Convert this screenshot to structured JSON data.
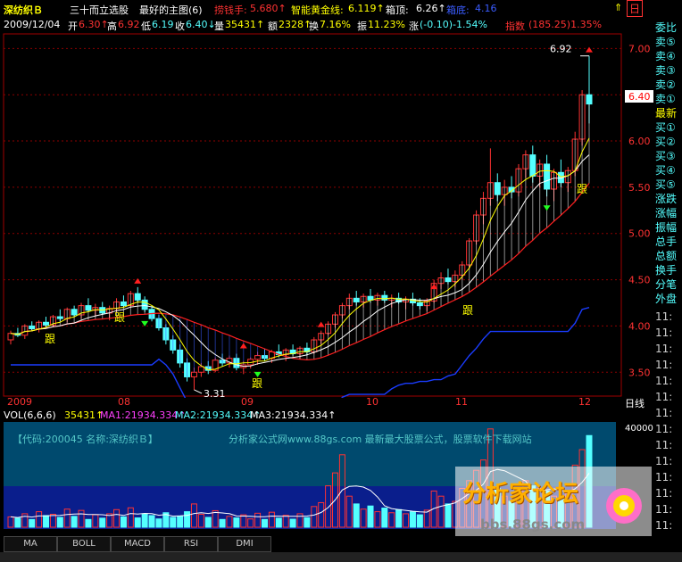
{
  "header": {
    "stock_name": "深纺织Ｂ",
    "indicator_title": "三十而立选股",
    "main_chart_label": "最好的主图(6)",
    "param1_label": "捞钱手:",
    "param1_value": "5.680↑",
    "param2_label": "智能黄金线:",
    "param2_value": "6.119↑",
    "param3_label": "箱顶:",
    "param3_value": "6.26↑",
    "param4_label": "箱底:",
    "param4_value": "4.16"
  },
  "quote": {
    "date": "2009/12/04",
    "open_label": "开",
    "open": "6.30↑",
    "high_label": "高",
    "high": "6.92",
    "low_label": "低",
    "low": "6.19",
    "close_label": "收",
    "close": "6.40↓",
    "volume_label": "量",
    "volume": "35431↑",
    "amount_label": "额",
    "amount": "2328↑",
    "turnover_label": "换",
    "turnover": "7.16%",
    "amplitude_label": "振",
    "amplitude": "11.23%",
    "change_label": "涨",
    "change": "(-0.10)-1.54%",
    "index_label": "指数",
    "index": "(185.25)1.35%"
  },
  "price_axis": [
    "7.00",
    "6.50",
    "6.00",
    "5.50",
    "5.00",
    "4.50",
    "4.00",
    "3.50"
  ],
  "current_price_badge": "6.40",
  "annotations": {
    "high_marker": "6.92",
    "low_marker": "3.31",
    "follow_label": "跟"
  },
  "x_axis_labels": [
    "2009",
    "08",
    "09",
    "10",
    "11",
    "12"
  ],
  "period_label": "日线",
  "volume_header": {
    "label": "VOL(6,6,6)",
    "value": "35431↑",
    "ma1": "MA1:21934.334↑",
    "ma2": "MA2:21934.334↑",
    "ma3": "MA3:21934.334↑"
  },
  "vol_axis": [
    "40000"
  ],
  "info_banner": {
    "code": "【代码:200045  名称:深纺织Ｂ】",
    "site": "分析家公式网www.88gs.com 最新最大股票公式，股票软件下载网站"
  },
  "tabs": [
    "MA",
    "BOLL",
    "MACD",
    "RSI",
    "DMI"
  ],
  "side_panel": {
    "top_title": "委比",
    "rows": [
      "卖⑤",
      "卖④",
      "卖③",
      "卖②",
      "卖①",
      "最新",
      "买①",
      "买②",
      "买③",
      "买④",
      "买⑤",
      "涨跌",
      "涨幅",
      "振幅",
      "总手",
      "总额",
      "换手",
      "分笔",
      "外盘"
    ],
    "times": [
      "11:",
      "11:",
      "11:",
      "11:",
      "11:",
      "11:",
      "11:",
      "11:",
      "11:",
      "11:",
      "11:",
      "11:",
      "11:",
      "11:",
      "11:"
    ]
  },
  "watermark": {
    "title": "分析家论坛",
    "url": "bbs.88gs.com"
  },
  "colors": {
    "up": "#ff3232",
    "down": "#54ffff",
    "ma_white": "#ffffff",
    "ma_yellow": "#ffff00",
    "box_line": "#1a3cff",
    "grid": "#8b0000",
    "header_yellow": "#ffff00",
    "header_red": "#ff3232",
    "banner_cyan": "#54c8c8"
  },
  "chart_data": {
    "type": "candlestick",
    "y_range": [
      3.3,
      7.1
    ],
    "volume_range": [
      0,
      40000
    ],
    "months": [
      "2009",
      "08",
      "09",
      "10",
      "11",
      "12"
    ],
    "ohlc": [
      [
        3.85,
        3.95,
        3.8,
        3.92
      ],
      [
        3.92,
        3.98,
        3.88,
        3.9
      ],
      [
        3.9,
        4.02,
        3.86,
        4.0
      ],
      [
        4.0,
        4.05,
        3.95,
        3.97
      ],
      [
        3.97,
        4.06,
        3.93,
        4.04
      ],
      [
        4.04,
        4.1,
        3.98,
        4.01
      ],
      [
        4.01,
        4.12,
        3.99,
        4.1
      ],
      [
        4.1,
        4.18,
        4.05,
        4.08
      ],
      [
        4.08,
        4.2,
        4.04,
        4.18
      ],
      [
        4.18,
        4.22,
        4.1,
        4.12
      ],
      [
        4.12,
        4.25,
        4.08,
        4.22
      ],
      [
        4.22,
        4.3,
        4.15,
        4.17
      ],
      [
        4.17,
        4.24,
        4.1,
        4.2
      ],
      [
        4.2,
        4.26,
        4.12,
        4.14
      ],
      [
        4.14,
        4.22,
        4.06,
        4.19
      ],
      [
        4.19,
        4.3,
        4.15,
        4.26
      ],
      [
        4.26,
        4.33,
        4.2,
        4.22
      ],
      [
        4.22,
        4.38,
        4.2,
        4.35
      ],
      [
        4.35,
        4.42,
        4.25,
        4.28
      ],
      [
        4.28,
        4.32,
        4.15,
        4.18
      ],
      [
        4.18,
        4.22,
        4.05,
        4.08
      ],
      [
        4.08,
        4.12,
        3.95,
        3.98
      ],
      [
        3.98,
        4.02,
        3.8,
        3.85
      ],
      [
        3.85,
        3.9,
        3.7,
        3.74
      ],
      [
        3.74,
        3.8,
        3.55,
        3.6
      ],
      [
        3.6,
        3.65,
        3.4,
        3.45
      ],
      [
        3.45,
        3.55,
        3.31,
        3.5
      ],
      [
        3.5,
        3.6,
        3.45,
        3.56
      ],
      [
        3.56,
        3.62,
        3.48,
        3.52
      ],
      [
        3.52,
        3.66,
        3.5,
        3.63
      ],
      [
        3.63,
        3.7,
        3.56,
        3.6
      ],
      [
        3.6,
        3.68,
        3.55,
        3.65
      ],
      [
        3.65,
        3.7,
        3.52,
        3.55
      ],
      [
        3.55,
        3.62,
        3.48,
        3.58
      ],
      [
        3.58,
        3.66,
        3.54,
        3.64
      ],
      [
        3.64,
        3.72,
        3.58,
        3.68
      ],
      [
        3.68,
        3.75,
        3.62,
        3.65
      ],
      [
        3.65,
        3.74,
        3.6,
        3.72
      ],
      [
        3.72,
        3.8,
        3.66,
        3.69
      ],
      [
        3.69,
        3.76,
        3.62,
        3.74
      ],
      [
        3.74,
        3.8,
        3.68,
        3.7
      ],
      [
        3.7,
        3.78,
        3.64,
        3.76
      ],
      [
        3.76,
        3.82,
        3.68,
        3.72
      ],
      [
        3.72,
        3.88,
        3.7,
        3.85
      ],
      [
        3.85,
        3.95,
        3.8,
        3.92
      ],
      [
        3.92,
        4.05,
        3.9,
        4.02
      ],
      [
        4.02,
        4.15,
        3.98,
        4.12
      ],
      [
        4.12,
        4.25,
        4.08,
        4.22
      ],
      [
        4.22,
        4.35,
        4.18,
        4.3
      ],
      [
        4.3,
        4.38,
        4.22,
        4.26
      ],
      [
        4.26,
        4.35,
        4.2,
        4.32
      ],
      [
        4.32,
        4.4,
        4.25,
        4.28
      ],
      [
        4.28,
        4.36,
        4.22,
        4.33
      ],
      [
        4.33,
        4.38,
        4.25,
        4.28
      ],
      [
        4.28,
        4.34,
        4.2,
        4.3
      ],
      [
        4.3,
        4.36,
        4.24,
        4.26
      ],
      [
        4.26,
        4.32,
        4.18,
        4.29
      ],
      [
        4.29,
        4.36,
        4.22,
        4.25
      ],
      [
        4.25,
        4.3,
        4.18,
        4.22
      ],
      [
        4.22,
        4.3,
        4.16,
        4.27
      ],
      [
        4.27,
        4.5,
        4.25,
        4.46
      ],
      [
        4.46,
        4.58,
        4.4,
        4.52
      ],
      [
        4.52,
        4.62,
        4.45,
        4.48
      ],
      [
        4.48,
        4.6,
        4.42,
        4.55
      ],
      [
        4.55,
        4.7,
        4.5,
        4.66
      ],
      [
        4.66,
        4.95,
        4.62,
        4.92
      ],
      [
        4.92,
        5.25,
        4.88,
        5.2
      ],
      [
        5.2,
        5.45,
        5.1,
        5.38
      ],
      [
        5.38,
        5.92,
        5.3,
        5.55
      ],
      [
        5.55,
        5.65,
        5.35,
        5.42
      ],
      [
        5.42,
        5.58,
        5.3,
        5.5
      ],
      [
        5.5,
        5.62,
        5.38,
        5.45
      ],
      [
        5.45,
        5.75,
        5.4,
        5.7
      ],
      [
        5.7,
        5.9,
        5.6,
        5.85
      ],
      [
        5.85,
        5.95,
        5.55,
        5.62
      ],
      [
        5.62,
        5.8,
        5.5,
        5.75
      ],
      [
        5.75,
        5.85,
        5.4,
        5.48
      ],
      [
        5.48,
        5.7,
        5.35,
        5.66
      ],
      [
        5.66,
        5.8,
        5.5,
        5.55
      ],
      [
        5.55,
        5.72,
        5.45,
        5.68
      ],
      [
        5.68,
        6.1,
        5.62,
        6.02
      ],
      [
        6.02,
        6.55,
        5.95,
        6.5
      ],
      [
        6.5,
        6.92,
        6.19,
        6.4
      ]
    ],
    "volumes": [
      4000,
      3500,
      5200,
      3000,
      6000,
      4500,
      5000,
      3800,
      7000,
      4200,
      6500,
      3000,
      4800,
      3500,
      5200,
      6800,
      4000,
      7500,
      3600,
      5000,
      4500,
      3200,
      5600,
      3800,
      4200,
      6000,
      9000,
      5000,
      3800,
      6400,
      3000,
      4200,
      3600,
      4800,
      3200,
      5400,
      3000,
      5800,
      3500,
      4600,
      3100,
      5200,
      3700,
      8000,
      9500,
      16000,
      21000,
      28000,
      12000,
      9000,
      7000,
      8200,
      6000,
      7400,
      5600,
      6800,
      5200,
      6000,
      4800,
      6600,
      14000,
      12000,
      9000,
      10000,
      15000,
      18000,
      22000,
      26000,
      38000,
      15000,
      12000,
      10000,
      14000,
      18000,
      16000,
      15000,
      14000,
      12000,
      11000,
      13000,
      24000,
      30000,
      35431
    ]
  }
}
